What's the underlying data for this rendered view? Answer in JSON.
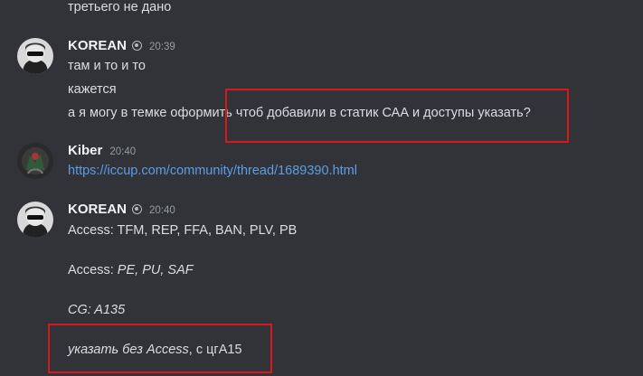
{
  "colors": {
    "background": "#313338",
    "text": "#dbdee1",
    "username": "#f2f3f5",
    "timestamp": "#949ba4",
    "link": "#5c9ee6",
    "highlight": "#d61a1a"
  },
  "messages": {
    "top_line": "третьего не дано",
    "group1": {
      "username": "KOREAN",
      "badge_icon": "shield-badge-icon",
      "time": "20:39",
      "lines": [
        "там и то и то",
        "кажется",
        "а я могу в темке оформить чтоб добавили в статик САА и доступы указать?"
      ]
    },
    "group2": {
      "username": "Kiber",
      "time": "20:40",
      "link": "https://iccup.com/community/thread/1689390.html"
    },
    "group3": {
      "username": "KOREAN",
      "badge_icon": "shield-badge-icon",
      "time": "20:40",
      "access_line": "Access: TFM, REP, FFA, BAN, PLV, PB",
      "access2_label": "Access: ",
      "access2_value": "PE, PU, SAF",
      "cg_line": "CG: A135",
      "last_italic": "указать без Access",
      "last_plain": ", с цгА15"
    }
  }
}
